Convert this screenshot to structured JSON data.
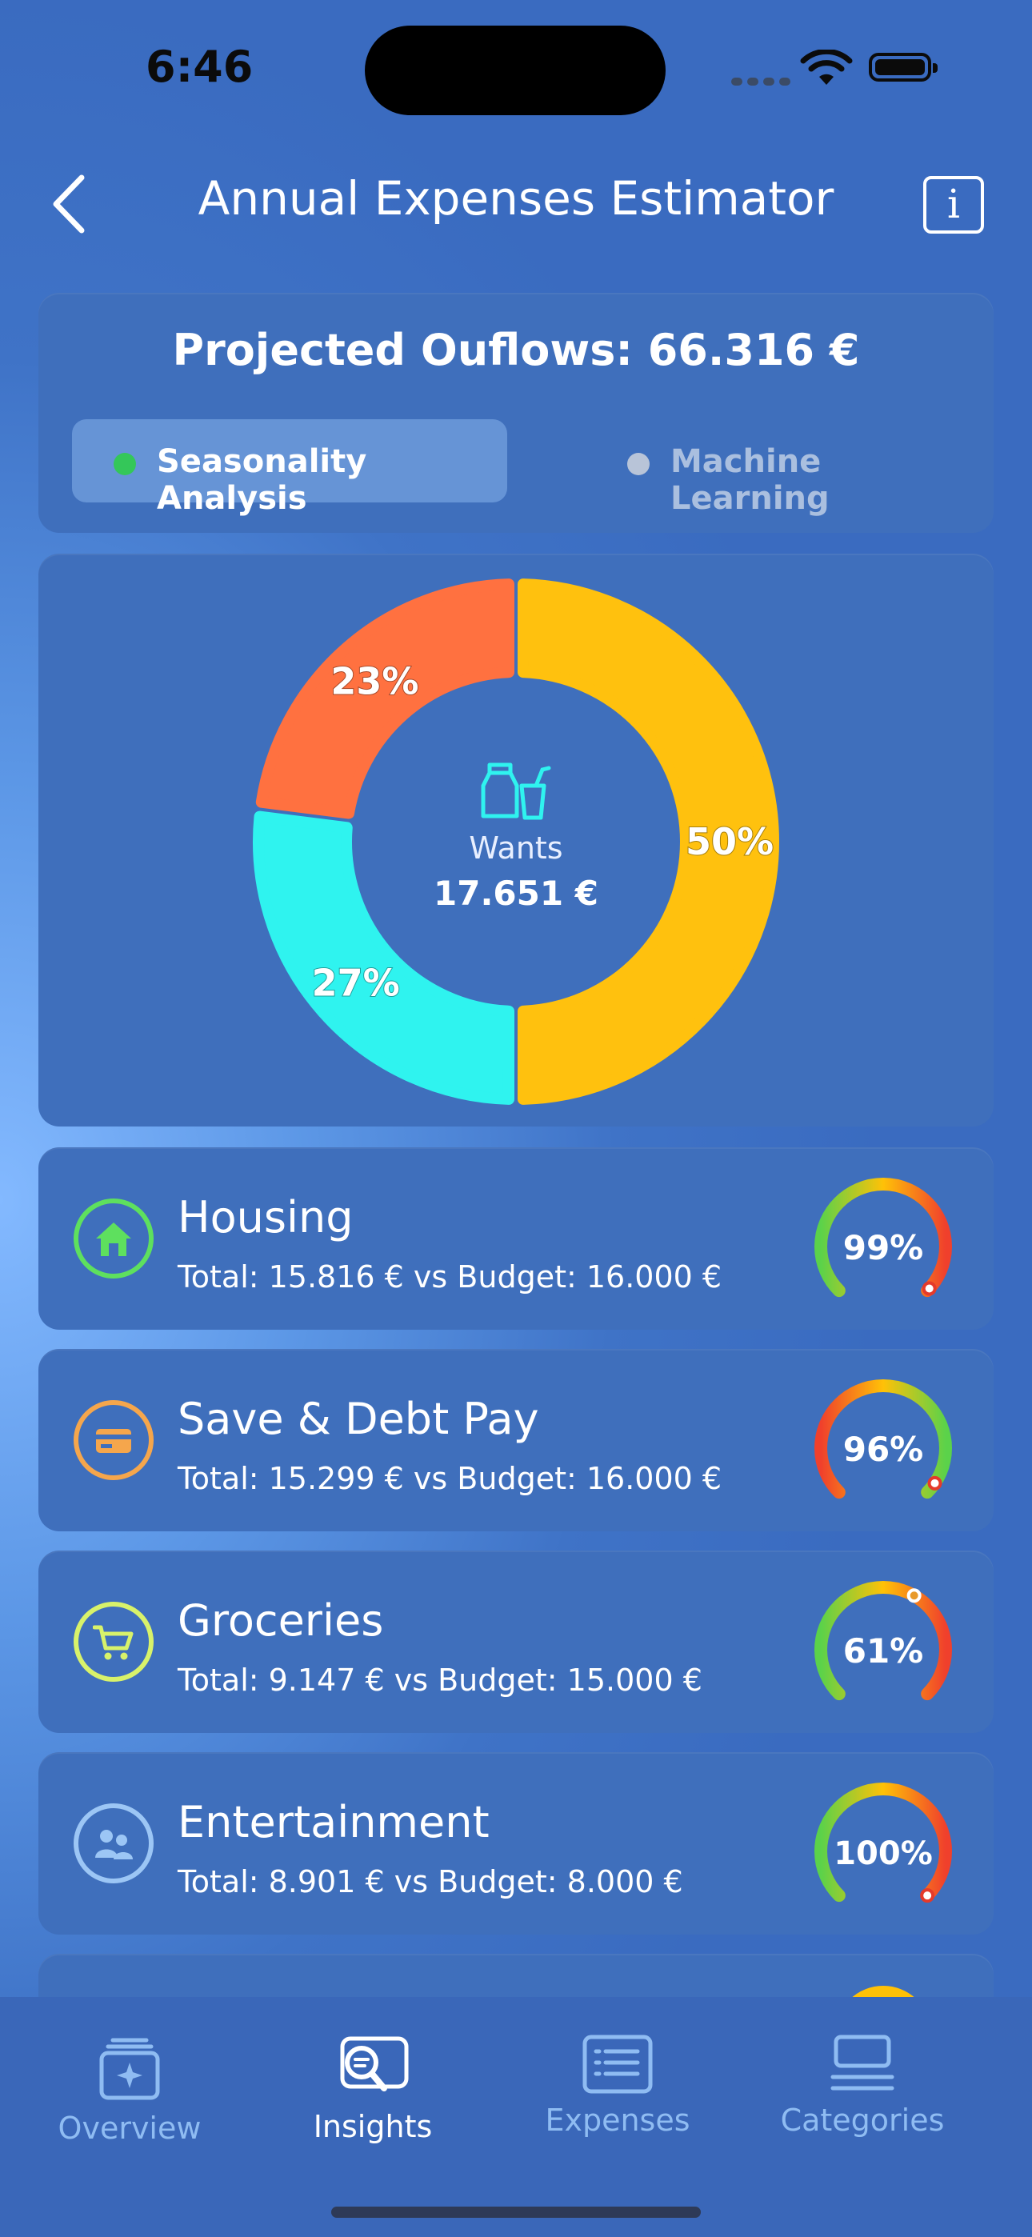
{
  "status_bar": {
    "time": "6:46"
  },
  "header": {
    "title": "Annual Expenses Estimator",
    "info_label": "i"
  },
  "projection": {
    "title": "Projected Ouflows: 66.316 €",
    "segments": [
      {
        "label": "Seasonality Analysis",
        "active": true,
        "dot_color": "#34c759"
      },
      {
        "label": "Machine Learning",
        "active": false,
        "dot_color": "#b8c4d8"
      }
    ]
  },
  "chart_data": {
    "type": "pie",
    "donut": true,
    "center_label": "Wants",
    "center_value": "17.651 €",
    "center_icon": "cup-and-bag-icon",
    "slices": [
      {
        "label": "50%",
        "value": 50,
        "color": "#ffc10e"
      },
      {
        "label": "27%",
        "value": 27,
        "color": "#2ff3ef"
      },
      {
        "label": "23%",
        "value": 23,
        "color": "#ff7140"
      }
    ]
  },
  "categories": [
    {
      "name": "Housing",
      "detail": "Total: 15.816 €  vs  Budget: 16.000 €",
      "percent": "99%",
      "ratio": 0.99,
      "icon": "house-icon",
      "icon_color": "#5ee05e"
    },
    {
      "name": "Save & Debt Pay",
      "detail": "Total: 15.299 €  vs  Budget: 16.000 €",
      "percent": "96%",
      "ratio": 0.96,
      "icon": "credit-card-icon",
      "icon_color": "#f5a64c"
    },
    {
      "name": "Groceries",
      "detail": "Total: 9.147 €  vs  Budget: 15.000 €",
      "percent": "61%",
      "ratio": 0.61,
      "icon": "cart-icon",
      "icon_color": "#d8f26a"
    },
    {
      "name": "Entertainment",
      "detail": "Total: 8.901 €  vs  Budget: 8.000 €",
      "percent": "100%",
      "ratio": 1.0,
      "icon": "people-icon",
      "icon_color": "#9cc6f5"
    }
  ],
  "tabs": [
    {
      "label": "Overview",
      "icon": "overview-icon",
      "active": false
    },
    {
      "label": "Insights",
      "icon": "insights-icon",
      "active": true
    },
    {
      "label": "Expenses",
      "icon": "expenses-list-icon",
      "active": false
    },
    {
      "label": "Categories",
      "icon": "categories-icon",
      "active": false
    }
  ],
  "colors": {
    "card": "#3f6fbc",
    "inactive_tab": "#8fbcf2",
    "gauge_green": "#5bd24a",
    "gauge_yellow": "#ffc107",
    "gauge_red": "#f0402c"
  }
}
